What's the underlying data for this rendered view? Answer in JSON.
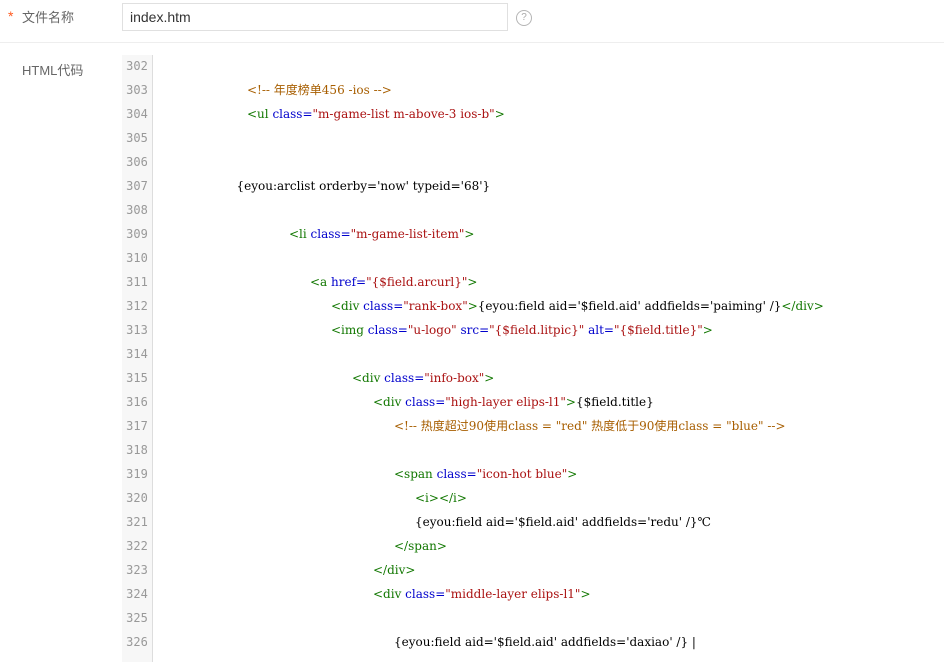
{
  "form": {
    "required_mark": "*",
    "filename_label": "文件名称",
    "filename_value": "index.htm",
    "help_icon": "question-circle-icon",
    "code_label": "HTML代码"
  },
  "editor": {
    "lines": [
      {
        "num": "302",
        "indent": 0,
        "tokens": []
      },
      {
        "num": "303",
        "indent": 8,
        "tokens": [
          {
            "t": "c",
            "v": "<!-- 年度榜单456 -ios -->"
          }
        ]
      },
      {
        "num": "304",
        "indent": 8,
        "tokens": [
          {
            "t": "g",
            "v": "<ul "
          },
          {
            "t": "a",
            "v": "class="
          },
          {
            "t": "s",
            "v": "\"m-game-list m-above-3 ios-b\""
          },
          {
            "t": "g",
            "v": ">"
          }
        ]
      },
      {
        "num": "305",
        "indent": 0,
        "tokens": []
      },
      {
        "num": "306",
        "indent": 0,
        "tokens": []
      },
      {
        "num": "307",
        "indent": 7,
        "tokens": [
          {
            "t": "p",
            "v": "{eyou:arclist orderby='now' typeid='68'}"
          }
        ]
      },
      {
        "num": "308",
        "indent": 0,
        "tokens": []
      },
      {
        "num": "309",
        "indent": 12,
        "tokens": [
          {
            "t": "g",
            "v": "<li "
          },
          {
            "t": "a",
            "v": "class="
          },
          {
            "t": "s",
            "v": "\"m-game-list-item\""
          },
          {
            "t": "g",
            "v": ">"
          }
        ]
      },
      {
        "num": "310",
        "indent": 0,
        "tokens": []
      },
      {
        "num": "311",
        "indent": 14,
        "tokens": [
          {
            "t": "g",
            "v": "<a "
          },
          {
            "t": "a",
            "v": "href="
          },
          {
            "t": "s",
            "v": "\"{$field.arcurl}\""
          },
          {
            "t": "g",
            "v": ">"
          }
        ]
      },
      {
        "num": "312",
        "indent": 16,
        "tokens": [
          {
            "t": "g",
            "v": "<div "
          },
          {
            "t": "a",
            "v": "class="
          },
          {
            "t": "s",
            "v": "\"rank-box\""
          },
          {
            "t": "g",
            "v": ">"
          },
          {
            "t": "p",
            "v": "{eyou:field aid='$field.aid' addfields='paiming' /}"
          },
          {
            "t": "g",
            "v": "</div>"
          }
        ]
      },
      {
        "num": "313",
        "indent": 16,
        "tokens": [
          {
            "t": "g",
            "v": "<img "
          },
          {
            "t": "a",
            "v": "class="
          },
          {
            "t": "s",
            "v": "\"u-logo\" "
          },
          {
            "t": "a",
            "v": "src="
          },
          {
            "t": "s",
            "v": "\"{$field.litpic}\" "
          },
          {
            "t": "a",
            "v": "alt="
          },
          {
            "t": "s",
            "v": "\"{$field.title}\""
          },
          {
            "t": "g",
            "v": ">"
          }
        ]
      },
      {
        "num": "314",
        "indent": 0,
        "tokens": []
      },
      {
        "num": "315",
        "indent": 18,
        "tokens": [
          {
            "t": "g",
            "v": "<div "
          },
          {
            "t": "a",
            "v": "class="
          },
          {
            "t": "s",
            "v": "\"info-box\""
          },
          {
            "t": "g",
            "v": ">"
          }
        ]
      },
      {
        "num": "316",
        "indent": 20,
        "tokens": [
          {
            "t": "g",
            "v": "<div "
          },
          {
            "t": "a",
            "v": "class="
          },
          {
            "t": "s",
            "v": "\"high-layer elips-l1\""
          },
          {
            "t": "g",
            "v": ">"
          },
          {
            "t": "p",
            "v": "{$field.title}"
          }
        ]
      },
      {
        "num": "317",
        "indent": 22,
        "tokens": [
          {
            "t": "c",
            "v": "<!-- 热度超过90使用class = \"red\" 热度低于90使用class = \"blue\" -->"
          }
        ]
      },
      {
        "num": "318",
        "indent": 0,
        "tokens": []
      },
      {
        "num": "319",
        "indent": 22,
        "tokens": [
          {
            "t": "g",
            "v": "<span "
          },
          {
            "t": "a",
            "v": "class="
          },
          {
            "t": "s",
            "v": "\"icon-hot blue\""
          },
          {
            "t": "g",
            "v": ">"
          }
        ]
      },
      {
        "num": "320",
        "indent": 24,
        "tokens": [
          {
            "t": "g",
            "v": "<i></i>"
          }
        ]
      },
      {
        "num": "321",
        "indent": 24,
        "tokens": [
          {
            "t": "p",
            "v": "{eyou:field aid='$field.aid' addfields='redu' /}℃"
          }
        ]
      },
      {
        "num": "322",
        "indent": 22,
        "tokens": [
          {
            "t": "g",
            "v": "</span>"
          }
        ]
      },
      {
        "num": "323",
        "indent": 20,
        "tokens": [
          {
            "t": "g",
            "v": "</div>"
          }
        ]
      },
      {
        "num": "324",
        "indent": 20,
        "tokens": [
          {
            "t": "g",
            "v": "<div "
          },
          {
            "t": "a",
            "v": "class="
          },
          {
            "t": "s",
            "v": "\"middle-layer elips-l1\""
          },
          {
            "t": "g",
            "v": ">"
          }
        ]
      },
      {
        "num": "325",
        "indent": 0,
        "tokens": []
      },
      {
        "num": "326",
        "indent": 22,
        "tokens": [
          {
            "t": "p",
            "v": "{eyou:field aid='$field.aid' addfields='daxiao' /} |"
          }
        ]
      }
    ]
  }
}
